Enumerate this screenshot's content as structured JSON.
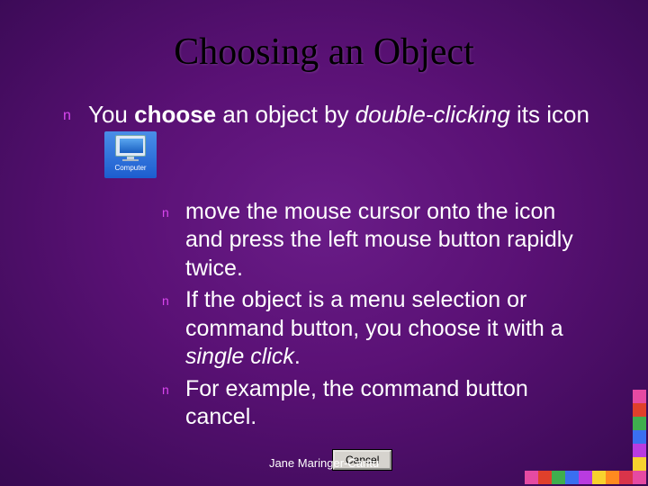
{
  "title": "Choosing an Object",
  "bullet_glyph": "n",
  "point1": {
    "pre": "You ",
    "bold": "choose",
    "mid": " an object by ",
    "italic": "double-clicking",
    "post": " its icon"
  },
  "computer_icon": {
    "label": "Computer"
  },
  "subpoints": [
    "move the mouse cursor onto the icon and press the left mouse button rapidly twice.",
    "",
    "For example, the command button cancel."
  ],
  "sub2": {
    "a": "If the object is a menu selection or command button, you choose it with a ",
    "i": "single click",
    "b": "."
  },
  "cancel_button_label": "Cancel",
  "footer": "Jane Maringer-Cantu",
  "square_colors_vertical": [
    "#e64aa2",
    "#e0402b",
    "#3fae4e",
    "#3a6ff0",
    "#b93be0",
    "#f7d22e"
  ],
  "square_colors_horizontal": [
    "#e64aa2",
    "#e0402b",
    "#3fae4e",
    "#3a6ff0",
    "#b93be0",
    "#f7d22e",
    "#ff8a1f",
    "#d9344a",
    "#e64aa2"
  ]
}
